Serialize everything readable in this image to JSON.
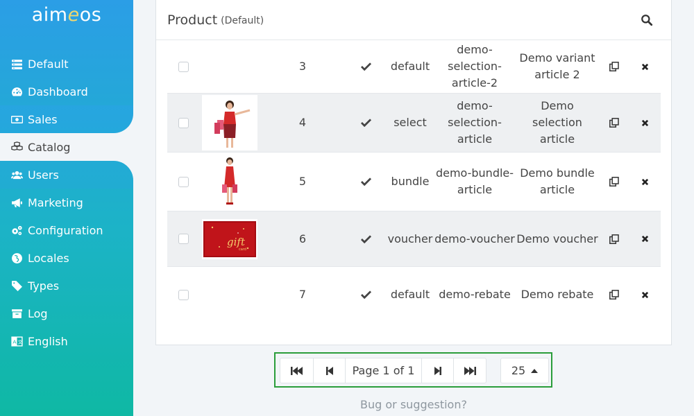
{
  "logo": {
    "pre": "aim",
    "e": "e",
    "post": "os"
  },
  "sidebar": {
    "items": [
      {
        "label": "Default",
        "icon": "list-icon"
      },
      {
        "label": "Dashboard",
        "icon": "dashboard-icon"
      },
      {
        "label": "Sales",
        "icon": "money-icon"
      },
      {
        "label": "Catalog",
        "icon": "cubes-icon"
      },
      {
        "label": "Users",
        "icon": "users-icon"
      },
      {
        "label": "Marketing",
        "icon": "bullhorn-icon"
      },
      {
        "label": "Configuration",
        "icon": "cogs-icon"
      },
      {
        "label": "Locales",
        "icon": "globe-icon"
      },
      {
        "label": "Types",
        "icon": "tag-icon"
      },
      {
        "label": "Log",
        "icon": "archive-icon"
      },
      {
        "label": "English",
        "icon": "language-icon"
      }
    ],
    "active": "Catalog"
  },
  "header": {
    "title": "Product",
    "subtitle": "(Default)"
  },
  "rows": [
    {
      "id": "3",
      "type": "default",
      "code": "demo-selection-article-2",
      "label": "Demo variant article 2",
      "image": "none"
    },
    {
      "id": "4",
      "type": "select",
      "code": "demo-selection-article",
      "label": "Demo selection article",
      "image": "woman-red-dress-shopping-bags"
    },
    {
      "id": "5",
      "type": "bundle",
      "code": "demo-bundle-article",
      "label": "Demo bundle article",
      "image": "woman-red-dress-standing"
    },
    {
      "id": "6",
      "type": "voucher",
      "code": "demo-voucher",
      "label": "Demo voucher",
      "image": "gift-card"
    },
    {
      "id": "7",
      "type": "default",
      "code": "demo-rebate",
      "label": "Demo rebate",
      "image": "none"
    }
  ],
  "pagination": {
    "page_text": "Page 1 of 1",
    "page_size": "25"
  },
  "footer": {
    "feedback": "Bug or suggestion?"
  },
  "colors": {
    "sidebar_top": "#2b9ee6",
    "sidebar_bottom": "#0fb8a4",
    "pager_border": "#2a9d3a"
  }
}
